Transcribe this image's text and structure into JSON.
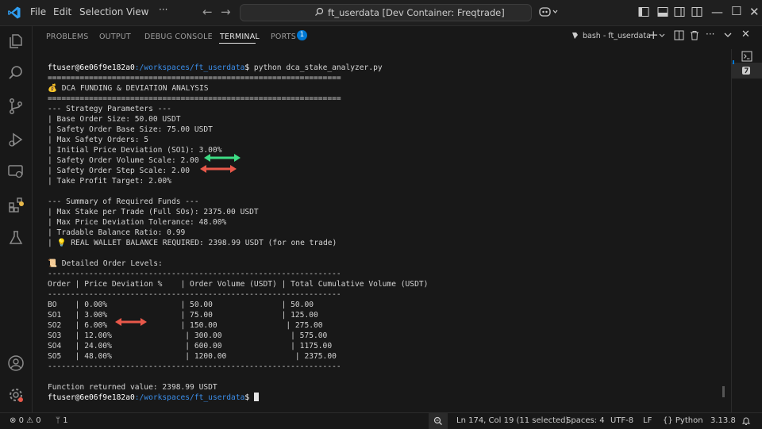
{
  "window": {
    "menu": [
      "File",
      "Edit",
      "Selection",
      "View"
    ],
    "more": "···",
    "search_text": "ft_userdata [Dev Container: Freqtrade]"
  },
  "panel": {
    "tabs": [
      "PROBLEMS",
      "OUTPUT",
      "DEBUG CONSOLE",
      "TERMINAL",
      "PORTS"
    ],
    "active_tab": "TERMINAL",
    "ports_badge": "1",
    "terminal_name": "bash - ft_userdata"
  },
  "terminal": {
    "prompt_user": "ftuser@6e06f9e182a0",
    "prompt_path": ":/workspaces/ft_userdata",
    "prompt_suffix": "$",
    "command": " python dca_stake_analyzer.py",
    "lines": [
      "================================================================",
      "💰 DCA FUNDING & DEVIATION ANALYSIS",
      "================================================================",
      "--- Strategy Parameters ---",
      "| Base Order Size: 50.00 USDT",
      "| Safety Order Base Size: 75.00 USDT",
      "| Max Safety Orders: 5",
      "| Initial Price Deviation (SO1): 3.00%",
      "| Safety Order Volume Scale: 2.00",
      "| Safety Order Step Scale: 2.00",
      "| Take Profit Target: 2.00%",
      "",
      "--- Summary of Required Funds ---",
      "| Max Stake per Trade (Full SOs): 2375.00 USDT",
      "| Max Price Deviation Tolerance: 48.00%",
      "| Tradable Balance Ratio: 0.99",
      "| 💡 REAL WALLET BALANCE REQUIRED: 2398.99 USDT (for one trade)",
      "",
      "📜 Detailed Order Levels:",
      "----------------------------------------------------------------",
      "Order | Price Deviation %    | Order Volume (USDT) | Total Cumulative Volume (USDT)",
      "----------------------------------------------------------------",
      "BO    | 0.00%                | 50.00               | 50.00",
      "SO1   | 3.00%                | 75.00               | 125.00",
      "SO2   | 6.00%                | 150.00               | 275.00",
      "SO3   | 12.00%                | 300.00               | 575.00",
      "SO4   | 24.00%                | 600.00               | 1175.00",
      "SO5   | 48.00%                | 1200.00               | 2375.00",
      "----------------------------------------------------------------",
      "",
      "Function returned value: 2398.99 USDT"
    ]
  },
  "status": {
    "errors": "0",
    "warnings": "0",
    "ports": "1",
    "cursor": "Ln 174, Col 19 (11 selected)",
    "spaces": "Spaces: 4",
    "encoding": "UTF-8",
    "eol": "LF",
    "language": "Python",
    "version": "3.13.8"
  },
  "colors": {
    "accent": "#0078d4",
    "path_blue": "#3b8eea",
    "arrow_green": "#3ddc84",
    "arrow_red": "#e8584a"
  }
}
